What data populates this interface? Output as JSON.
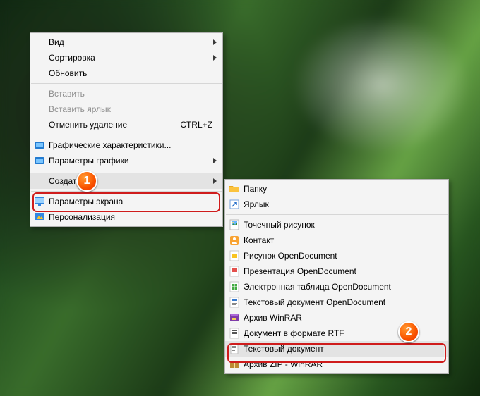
{
  "menu1": {
    "items": [
      {
        "label": "Вид",
        "submenu": true
      },
      {
        "label": "Сортировка",
        "submenu": true
      },
      {
        "label": "Обновить"
      },
      {
        "sep": true
      },
      {
        "label": "Вставить",
        "disabled": true
      },
      {
        "label": "Вставить ярлык",
        "disabled": true
      },
      {
        "label": "Отменить удаление",
        "hotkey": "CTRL+Z"
      },
      {
        "sep": true
      },
      {
        "label": "Графические характеристики...",
        "icon": "intel"
      },
      {
        "label": "Параметры графики",
        "icon": "intel",
        "submenu": true
      },
      {
        "sep": true
      },
      {
        "label": "Создать",
        "submenu": true,
        "hover": true
      },
      {
        "sep": true
      },
      {
        "label": "Параметры экрана",
        "icon": "display"
      },
      {
        "label": "Персонализация",
        "icon": "personalize"
      }
    ]
  },
  "menu2": {
    "items": [
      {
        "label": "Папку",
        "icon": "folder"
      },
      {
        "label": "Ярлык",
        "icon": "shortcut"
      },
      {
        "sep": true
      },
      {
        "label": "Точечный рисунок",
        "icon": "bmp"
      },
      {
        "label": "Контакт",
        "icon": "contact"
      },
      {
        "label": "Рисунок OpenDocument",
        "icon": "odg"
      },
      {
        "label": "Презентация OpenDocument",
        "icon": "odp"
      },
      {
        "label": "Электронная таблица OpenDocument",
        "icon": "ods"
      },
      {
        "label": "Текстовый документ OpenDocument",
        "icon": "odt"
      },
      {
        "label": "Архив WinRAR",
        "icon": "rar"
      },
      {
        "label": "Документ в формате RTF",
        "icon": "rtf"
      },
      {
        "label": "Текстовый документ",
        "icon": "txt",
        "hover": true
      },
      {
        "label": "Архив ZIP - WinRAR",
        "icon": "zip"
      }
    ]
  },
  "badges": {
    "b1": "1",
    "b2": "2"
  }
}
